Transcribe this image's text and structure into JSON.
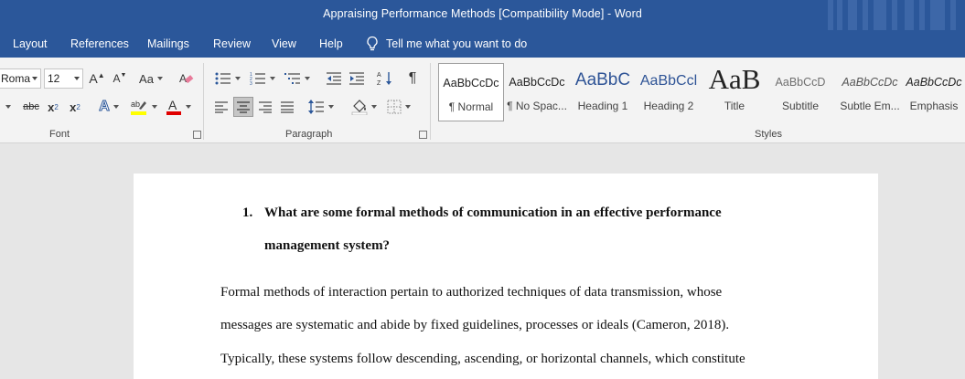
{
  "window": {
    "title": "Appraising Performance Methods [Compatibility Mode]  -  Word"
  },
  "tabs": [
    {
      "label": "Layout"
    },
    {
      "label": "References"
    },
    {
      "label": "Mailings"
    },
    {
      "label": "Review"
    },
    {
      "label": "View"
    },
    {
      "label": "Help"
    }
  ],
  "tell_me": {
    "placeholder": "Tell me what you want to do",
    "icon": "lightbulb-icon"
  },
  "font_group": {
    "label": "Font",
    "font_name": "Roma",
    "font_size": "12",
    "grow": "A",
    "shrink": "A",
    "case": "Aa",
    "strike": "abc",
    "subscript": "x",
    "superscript": "x",
    "effects": "A",
    "highlight_color": "#ffff00",
    "font_color": "#e00000"
  },
  "paragraph_group": {
    "label": "Paragraph",
    "pilcrow": "¶"
  },
  "styles_group": {
    "label": "Styles",
    "items": [
      {
        "preview": "AaBbCcDc",
        "name": "¶ Normal",
        "selected": true
      },
      {
        "preview": "AaBbCcDc",
        "name": "¶ No Spac..."
      },
      {
        "preview": "AaBbC",
        "name": "Heading 1"
      },
      {
        "preview": "AaBbCcl",
        "name": "Heading 2"
      },
      {
        "preview": "AaB",
        "name": "Title"
      },
      {
        "preview": "AaBbCcD",
        "name": "Subtitle"
      },
      {
        "preview": "AaBbCcDc",
        "name": "Subtle Em..."
      },
      {
        "preview": "AaBbCcDc",
        "name": "Emphasis"
      }
    ]
  },
  "document": {
    "question_number": "1.",
    "question_lines": [
      "What are some formal methods of communication in an effective performance",
      "management system?"
    ],
    "paragraph_lines": [
      "Formal methods of interaction pertain to authorized techniques of data transmission, whose",
      "messages are systematic and abide by fixed guidelines, processes or ideals (Cameron, 2018).",
      "Typically, these systems follow descending, ascending, or horizontal channels, which constitute"
    ]
  }
}
